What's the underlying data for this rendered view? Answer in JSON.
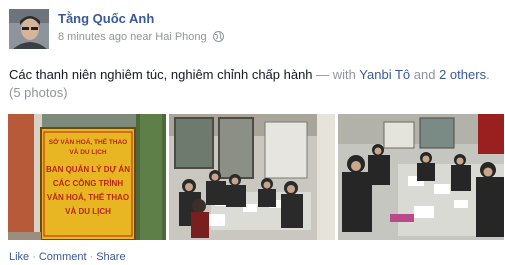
{
  "post": {
    "author": "Tằng Quốc Anh",
    "time": "8 minutes ago",
    "location_prefix": "near",
    "location": "Hai Phong",
    "privacy_icon": "globe-icon",
    "text": "Các thanh niên nghiêm túc, nghiêm chỉnh chấp hành",
    "with_separator": "— with",
    "tag_1": "Yanbi Tô",
    "tag_and": "and",
    "tag_others": "2 others",
    "tag_period": ".",
    "photo_count": "(5 photos)"
  },
  "photos": {
    "sign_lines": [
      "SỞ VĂN HOÁ, THỂ THAO",
      "VÀ DU LỊCH",
      "BAN QUẢN LÝ DỰ ÁN",
      "CÁC CÔNG TRÌNH",
      "VĂN HOÁ, THỂ THAO",
      "VÀ DU LỊCH"
    ]
  },
  "actions": {
    "like": "Like",
    "comment": "Comment",
    "share": "Share",
    "separator": "·"
  },
  "colors": {
    "link": "#3b5998",
    "muted": "#90949c",
    "text": "#141823",
    "sign_background": "#e8b623",
    "sign_text": "#b8261a"
  }
}
